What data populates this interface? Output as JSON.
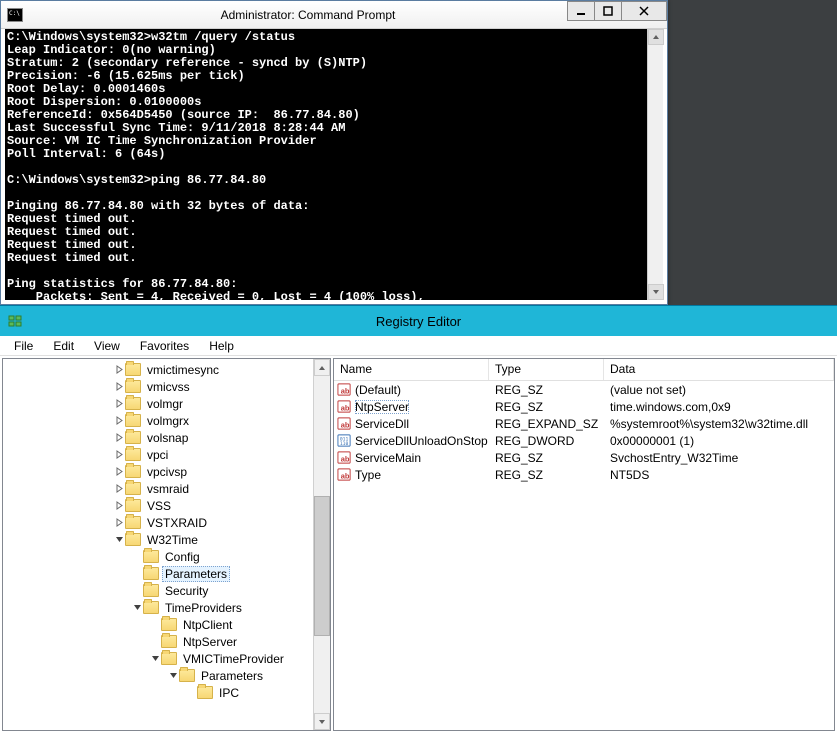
{
  "cmd": {
    "title": "Administrator: Command Prompt",
    "prompt1": "C:\\Windows\\system32>",
    "command1": "w32tm /query /status",
    "lines1": [
      "Leap Indicator: 0(no warning)",
      "Stratum: 2 (secondary reference - syncd by (S)NTP)",
      "Precision: -6 (15.625ms per tick)",
      "Root Delay: 0.0001460s",
      "Root Dispersion: 0.0100000s",
      "ReferenceId: 0x564D5450 (source IP:  86.77.84.80)",
      "Last Successful Sync Time: 9/11/2018 8:28:44 AM",
      "Source: VM IC Time Synchronization Provider",
      "Poll Interval: 6 (64s)"
    ],
    "prompt2": "C:\\Windows\\system32>",
    "command2": "ping 86.77.84.80",
    "ping_header": "Pinging 86.77.84.80 with 32 bytes of data:",
    "ping_lines": [
      "Request timed out.",
      "Request timed out.",
      "Request timed out.",
      "Request timed out."
    ],
    "stats_header": "Ping statistics for 86.77.84.80:",
    "stats_line": "    Packets: Sent = 4, Received = 0, Lost = 4 (100% loss),"
  },
  "reg": {
    "title": "Registry Editor",
    "menu": {
      "file": "File",
      "edit": "Edit",
      "view": "View",
      "favorites": "Favorites",
      "help": "Help"
    },
    "tree": {
      "items": [
        {
          "indent": 110,
          "exp": "closed",
          "label": "vmictimesync"
        },
        {
          "indent": 110,
          "exp": "closed",
          "label": "vmicvss"
        },
        {
          "indent": 110,
          "exp": "closed",
          "label": "volmgr"
        },
        {
          "indent": 110,
          "exp": "closed",
          "label": "volmgrx"
        },
        {
          "indent": 110,
          "exp": "closed",
          "label": "volsnap"
        },
        {
          "indent": 110,
          "exp": "closed",
          "label": "vpci"
        },
        {
          "indent": 110,
          "exp": "closed",
          "label": "vpcivsp"
        },
        {
          "indent": 110,
          "exp": "closed",
          "label": "vsmraid"
        },
        {
          "indent": 110,
          "exp": "closed",
          "label": "VSS"
        },
        {
          "indent": 110,
          "exp": "closed",
          "label": "VSTXRAID"
        },
        {
          "indent": 110,
          "exp": "open",
          "label": "W32Time"
        },
        {
          "indent": 128,
          "exp": "none",
          "label": "Config"
        },
        {
          "indent": 128,
          "exp": "none",
          "label": "Parameters",
          "selected": true
        },
        {
          "indent": 128,
          "exp": "none",
          "label": "Security"
        },
        {
          "indent": 128,
          "exp": "open",
          "label": "TimeProviders"
        },
        {
          "indent": 146,
          "exp": "none",
          "label": "NtpClient"
        },
        {
          "indent": 146,
          "exp": "none",
          "label": "NtpServer"
        },
        {
          "indent": 146,
          "exp": "open",
          "label": "VMICTimeProvider"
        },
        {
          "indent": 164,
          "exp": "open",
          "label": "Parameters"
        },
        {
          "indent": 182,
          "exp": "none",
          "label": "IPC"
        }
      ]
    },
    "list": {
      "headers": {
        "name": "Name",
        "type": "Type",
        "data": "Data"
      },
      "rows": [
        {
          "icon": "str",
          "name": "(Default)",
          "type": "REG_SZ",
          "data": "(value not set)"
        },
        {
          "icon": "str",
          "name": "NtpServer",
          "type": "REG_SZ",
          "data": "time.windows.com,0x9",
          "selected": true
        },
        {
          "icon": "str",
          "name": "ServiceDll",
          "type": "REG_EXPAND_SZ",
          "data": "%systemroot%\\system32\\w32time.dll"
        },
        {
          "icon": "bin",
          "name": "ServiceDllUnloadOnStop",
          "type": "REG_DWORD",
          "data": "0x00000001 (1)"
        },
        {
          "icon": "str",
          "name": "ServiceMain",
          "type": "REG_SZ",
          "data": "SvchostEntry_W32Time"
        },
        {
          "icon": "str",
          "name": "Type",
          "type": "REG_SZ",
          "data": "NT5DS"
        }
      ]
    }
  }
}
